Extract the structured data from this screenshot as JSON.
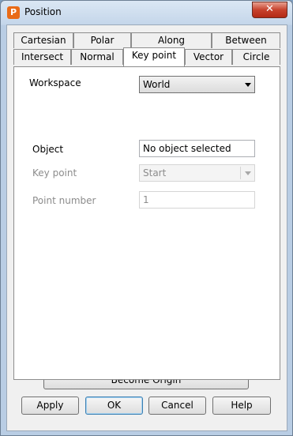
{
  "window": {
    "title": "Position",
    "app_icon": "P",
    "close_glyph": "✕"
  },
  "tabs_row1": [
    {
      "label": "Cartesian"
    },
    {
      "label": "Polar"
    },
    {
      "label": "Along"
    },
    {
      "label": "Between"
    }
  ],
  "tabs_row2": [
    {
      "label": "Intersect"
    },
    {
      "label": "Normal"
    },
    {
      "label": "Key point",
      "active": true
    },
    {
      "label": "Vector"
    },
    {
      "label": "Circle"
    }
  ],
  "form": {
    "workspace_label": "Workspace",
    "workspace_value": "World",
    "object_label": "Object",
    "object_value": "No object selected",
    "keypoint_label": "Key point",
    "keypoint_value": "Start",
    "point_number_label": "Point number",
    "point_number_value": "1"
  },
  "buttons": {
    "become_origin": "Become Origin",
    "apply": "Apply",
    "ok": "OK",
    "cancel": "Cancel",
    "help": "Help"
  }
}
